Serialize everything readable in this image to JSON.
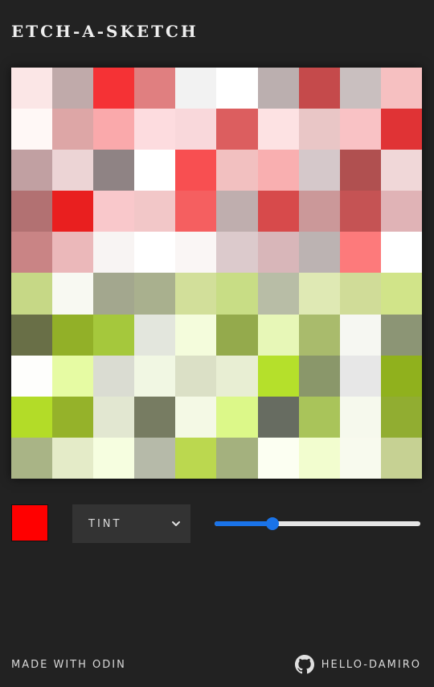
{
  "app": {
    "title": "ETCH-A-SKETCH"
  },
  "grid": {
    "size": 10,
    "cells": [
      [
        "#fbe6e6",
        "#c0aaaa",
        "#f53235",
        "#e07f80",
        "#f2f2f2",
        "#ffffff",
        "#bbafaf",
        "#c54a4b",
        "#c9bfbf",
        "#f6c0c1"
      ],
      [
        "#fff8f6",
        "#dda6a6",
        "#faa9ab",
        "#fddcdf",
        "#f9d8db",
        "#dc5e5f",
        "#fde2e3",
        "#e9c6c6",
        "#f9c2c5",
        "#e03335"
      ],
      [
        "#c1a0a2",
        "#ecd4d5",
        "#8f8384",
        "#ffffff",
        "#f84f51",
        "#f2c0c0",
        "#f9afb0",
        "#d5c8ca",
        "#b05050",
        "#f0d7d8"
      ],
      [
        "#b27172",
        "#e91f1f",
        "#f9c8cb",
        "#f2c7c8",
        "#f55f60",
        "#bfaeae",
        "#d74a4b",
        "#cb9899",
        "#c55354",
        "#e0b3b6"
      ],
      [
        "#c98485",
        "#ebb8ba",
        "#f8f4f3",
        "#ffffff",
        "#faf6f5",
        "#dccacc",
        "#d8b6b9",
        "#bcb3b2",
        "#fd7a7b",
        "#ffffff"
      ],
      [
        "#c6d886",
        "#f8f9f2",
        "#a3a78e",
        "#a9b08e",
        "#d2df9a",
        "#c8dd85",
        "#b8bda6",
        "#dfe9b4",
        "#d0dc98",
        "#d1e489"
      ],
      [
        "#696f47",
        "#92b028",
        "#a5c83c",
        "#e3e6dd",
        "#f4fcdc",
        "#94aa4c",
        "#e7f7b7",
        "#a9bb6c",
        "#f6f7f2",
        "#8c9575"
      ],
      [
        "#fefefc",
        "#e6fba3",
        "#dadcd2",
        "#f1f7e3",
        "#dbe0c6",
        "#e8eed3",
        "#b5e02b",
        "#8a976a",
        "#e7e7e7",
        "#90b11d"
      ],
      [
        "#b3dc28",
        "#95b22a",
        "#e2e7d1",
        "#777c62",
        "#f4f9e5",
        "#dcf889",
        "#676c61",
        "#a9c45a",
        "#f6f9ed",
        "#91ad31"
      ],
      [
        "#a9b486",
        "#e4ebc8",
        "#f6fee0",
        "#b6baa9",
        "#bbd84f",
        "#a4b17e",
        "#fcfff2",
        "#f2fdcf",
        "#f8faee",
        "#c6d193"
      ]
    ]
  },
  "controls": {
    "pen_color": "#ff0000",
    "mode_label": "TINT",
    "mode_icon": "chevron-down-icon",
    "slider_value_pct": 28
  },
  "footer": {
    "made_with": "MADE WITH ODIN",
    "github_user": "HELLO-DAMIRO",
    "github_icon": "github-icon"
  }
}
